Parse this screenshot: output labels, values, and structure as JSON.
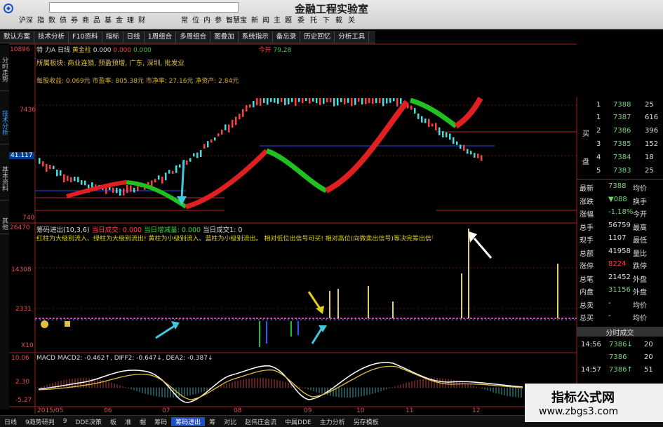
{
  "app": {
    "title": "金融工程实验室",
    "menu": [
      "沪深",
      "指",
      "数",
      "债",
      "券",
      "商",
      "品",
      "基",
      "金",
      "理",
      "财"
    ],
    "menu2": [
      "委",
      "托",
      "下",
      "载",
      "关"
    ],
    "win_icons": [
      "常",
      "位",
      "内",
      "参",
      "智慧宝",
      "新",
      "闻",
      "主",
      "题"
    ]
  },
  "toolbar": [
    "默认方案",
    "技术分析",
    "F10资料",
    "指标",
    "日线",
    "1周组合",
    "多周组合",
    "图叠加",
    "系统指示",
    "备忘录",
    "历史回忆",
    "分析工具"
  ],
  "left_tabs": [
    "分时走势",
    "技术分析",
    "基本资料",
    "其他"
  ],
  "header": {
    "code": "特",
    "name": "力A",
    "period": "日线",
    "label": "黄金柱",
    "v1": "0.000",
    "v2": "0.000",
    "v3": "0.000",
    "pre": "今开",
    "open": "79.28",
    "industry": "所属板块: 商业连锁, 预盈预增, 广东, 深圳, 批发业",
    "eps": "每股收益: 0.069元  市盈率: 805.38元  市净率: 27.16元  净资产: 2.84元"
  },
  "price_axis": [
    "10896",
    "7436",
    "41.117",
    "740"
  ],
  "indicator": {
    "title": "筹码进出(10,3,6)",
    "a_label": "当日成交: ",
    "a_val": "0.000",
    "b_label": "当日增减量: ",
    "b_val": "0.000",
    "c_label": "当日成交1: ",
    "c_val": "0",
    "desc": "红柱为大级别流入、绿柱为大级别流出! 黄柱为小级别流入、蓝柱为小级别流出。 相对低位出信号可买! 相对高位(向微卖出信号)等决完筹出信号再买!",
    "axis": [
      "26470",
      "14308",
      "2331",
      "X10"
    ]
  },
  "macd": {
    "title": "MACD MACD2: -0.462↑, DIFF2: -0.647↓, DEA2: -0.387↓",
    "axis": [
      "10.06",
      "2.30",
      "-5.27"
    ]
  },
  "date_axis": [
    "2015/05",
    "06",
    "07",
    "08",
    "09",
    "10",
    "11",
    "12"
  ],
  "order_book": {
    "sell_label": "卖",
    "buy_label1": "买",
    "buy_label2": "盘",
    "sell": [
      {
        "lv": "1",
        "price": "7388",
        "vol": "25"
      }
    ],
    "buy": [
      {
        "lv": "1",
        "price": "7387",
        "vol": "616"
      },
      {
        "lv": "2",
        "price": "7386",
        "vol": "396"
      },
      {
        "lv": "3",
        "price": "7385",
        "vol": "152"
      },
      {
        "lv": "4",
        "price": "7384",
        "vol": "18"
      },
      {
        "lv": "5",
        "price": "7383",
        "vol": "25"
      }
    ]
  },
  "quote": [
    {
      "k1": "最新",
      "v1": "7388",
      "c1": "#6fd66f",
      "k2": "均价"
    },
    {
      "k1": "涨跌",
      "v1": "▼088",
      "c1": "#6fd66f",
      "k2": "换手"
    },
    {
      "k1": "涨幅",
      "v1": "-1.18%",
      "c1": "#6fd66f",
      "k2": "今开"
    },
    {
      "k1": "总手",
      "v1": "56759",
      "c1": "#e0e0e0",
      "k2": "最高"
    },
    {
      "k1": "现手",
      "v1": "1107",
      "c1": "#e0e0e0",
      "k2": "最低"
    },
    {
      "k1": "总额",
      "v1": "41958",
      "c1": "#e0e0e0",
      "k2": "量比"
    },
    {
      "k1": "涨停",
      "v1": "8224",
      "c1": "#ff4040",
      "k2": "跌停"
    },
    {
      "k1": "总笔",
      "v1": "21452",
      "c1": "#e0e0e0",
      "k2": "外盘"
    },
    {
      "k1": "内盘",
      "v1": "31156",
      "c1": "#6fd66f",
      "k2": "外盘"
    },
    {
      "k1": "总卖",
      "v1": "-",
      "c1": "#e0e0e0",
      "k2": "均价"
    },
    {
      "k1": "总买",
      "v1": "-",
      "c1": "#e0e0e0",
      "k2": "均价"
    }
  ],
  "ticks_title": "分时成交",
  "ticks": [
    {
      "t": "14:56",
      "p": "7386↓",
      "v": "20"
    },
    {
      "t": "",
      "p": "7386",
      "v": "20"
    },
    {
      "t": "14:57",
      "p": "7386↑",
      "v": "51"
    }
  ],
  "bottom_tabs": [
    "日线",
    "9趋势研判",
    "9",
    "DDE决策",
    "板",
    "准",
    "帽",
    "筹码",
    "筹码进出",
    "筹",
    "对比",
    "赵伟庄金流",
    "中属DDE",
    "主力分析",
    "另存模板"
  ],
  "watermark": {
    "line1": "指标公式网",
    "line2": "www.zbgs3.com"
  },
  "colors": {
    "up": "#ff2020",
    "down": "#20c020",
    "accent": "#2060d0"
  }
}
